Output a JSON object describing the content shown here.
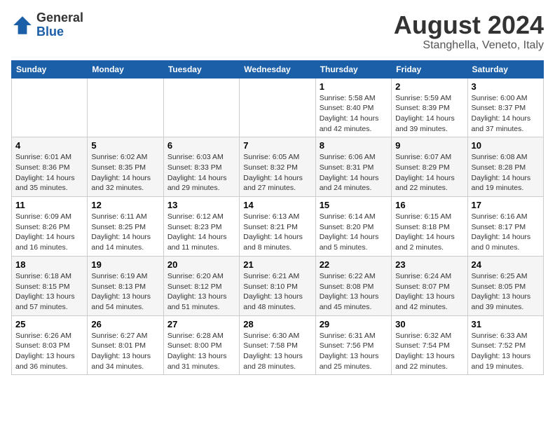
{
  "header": {
    "logo_general": "General",
    "logo_blue": "Blue",
    "month_year": "August 2024",
    "location": "Stanghella, Veneto, Italy"
  },
  "weekdays": [
    "Sunday",
    "Monday",
    "Tuesday",
    "Wednesday",
    "Thursday",
    "Friday",
    "Saturday"
  ],
  "weeks": [
    [
      {
        "day": "",
        "info": ""
      },
      {
        "day": "",
        "info": ""
      },
      {
        "day": "",
        "info": ""
      },
      {
        "day": "",
        "info": ""
      },
      {
        "day": "1",
        "info": "Sunrise: 5:58 AM\nSunset: 8:40 PM\nDaylight: 14 hours and 42 minutes."
      },
      {
        "day": "2",
        "info": "Sunrise: 5:59 AM\nSunset: 8:39 PM\nDaylight: 14 hours and 39 minutes."
      },
      {
        "day": "3",
        "info": "Sunrise: 6:00 AM\nSunset: 8:37 PM\nDaylight: 14 hours and 37 minutes."
      }
    ],
    [
      {
        "day": "4",
        "info": "Sunrise: 6:01 AM\nSunset: 8:36 PM\nDaylight: 14 hours and 35 minutes."
      },
      {
        "day": "5",
        "info": "Sunrise: 6:02 AM\nSunset: 8:35 PM\nDaylight: 14 hours and 32 minutes."
      },
      {
        "day": "6",
        "info": "Sunrise: 6:03 AM\nSunset: 8:33 PM\nDaylight: 14 hours and 29 minutes."
      },
      {
        "day": "7",
        "info": "Sunrise: 6:05 AM\nSunset: 8:32 PM\nDaylight: 14 hours and 27 minutes."
      },
      {
        "day": "8",
        "info": "Sunrise: 6:06 AM\nSunset: 8:31 PM\nDaylight: 14 hours and 24 minutes."
      },
      {
        "day": "9",
        "info": "Sunrise: 6:07 AM\nSunset: 8:29 PM\nDaylight: 14 hours and 22 minutes."
      },
      {
        "day": "10",
        "info": "Sunrise: 6:08 AM\nSunset: 8:28 PM\nDaylight: 14 hours and 19 minutes."
      }
    ],
    [
      {
        "day": "11",
        "info": "Sunrise: 6:09 AM\nSunset: 8:26 PM\nDaylight: 14 hours and 16 minutes."
      },
      {
        "day": "12",
        "info": "Sunrise: 6:11 AM\nSunset: 8:25 PM\nDaylight: 14 hours and 14 minutes."
      },
      {
        "day": "13",
        "info": "Sunrise: 6:12 AM\nSunset: 8:23 PM\nDaylight: 14 hours and 11 minutes."
      },
      {
        "day": "14",
        "info": "Sunrise: 6:13 AM\nSunset: 8:21 PM\nDaylight: 14 hours and 8 minutes."
      },
      {
        "day": "15",
        "info": "Sunrise: 6:14 AM\nSunset: 8:20 PM\nDaylight: 14 hours and 5 minutes."
      },
      {
        "day": "16",
        "info": "Sunrise: 6:15 AM\nSunset: 8:18 PM\nDaylight: 14 hours and 2 minutes."
      },
      {
        "day": "17",
        "info": "Sunrise: 6:16 AM\nSunset: 8:17 PM\nDaylight: 14 hours and 0 minutes."
      }
    ],
    [
      {
        "day": "18",
        "info": "Sunrise: 6:18 AM\nSunset: 8:15 PM\nDaylight: 13 hours and 57 minutes."
      },
      {
        "day": "19",
        "info": "Sunrise: 6:19 AM\nSunset: 8:13 PM\nDaylight: 13 hours and 54 minutes."
      },
      {
        "day": "20",
        "info": "Sunrise: 6:20 AM\nSunset: 8:12 PM\nDaylight: 13 hours and 51 minutes."
      },
      {
        "day": "21",
        "info": "Sunrise: 6:21 AM\nSunset: 8:10 PM\nDaylight: 13 hours and 48 minutes."
      },
      {
        "day": "22",
        "info": "Sunrise: 6:22 AM\nSunset: 8:08 PM\nDaylight: 13 hours and 45 minutes."
      },
      {
        "day": "23",
        "info": "Sunrise: 6:24 AM\nSunset: 8:07 PM\nDaylight: 13 hours and 42 minutes."
      },
      {
        "day": "24",
        "info": "Sunrise: 6:25 AM\nSunset: 8:05 PM\nDaylight: 13 hours and 39 minutes."
      }
    ],
    [
      {
        "day": "25",
        "info": "Sunrise: 6:26 AM\nSunset: 8:03 PM\nDaylight: 13 hours and 36 minutes."
      },
      {
        "day": "26",
        "info": "Sunrise: 6:27 AM\nSunset: 8:01 PM\nDaylight: 13 hours and 34 minutes."
      },
      {
        "day": "27",
        "info": "Sunrise: 6:28 AM\nSunset: 8:00 PM\nDaylight: 13 hours and 31 minutes."
      },
      {
        "day": "28",
        "info": "Sunrise: 6:30 AM\nSunset: 7:58 PM\nDaylight: 13 hours and 28 minutes."
      },
      {
        "day": "29",
        "info": "Sunrise: 6:31 AM\nSunset: 7:56 PM\nDaylight: 13 hours and 25 minutes."
      },
      {
        "day": "30",
        "info": "Sunrise: 6:32 AM\nSunset: 7:54 PM\nDaylight: 13 hours and 22 minutes."
      },
      {
        "day": "31",
        "info": "Sunrise: 6:33 AM\nSunset: 7:52 PM\nDaylight: 13 hours and 19 minutes."
      }
    ]
  ]
}
